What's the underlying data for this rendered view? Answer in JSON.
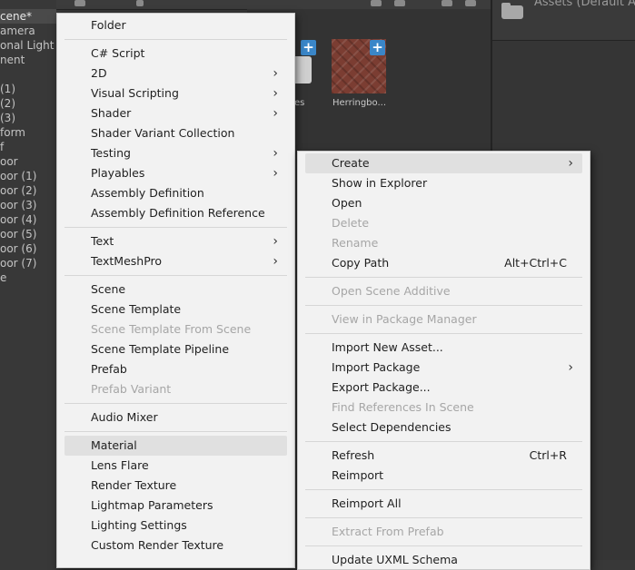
{
  "hierarchy": {
    "items": [
      {
        "label": "cene*",
        "selected": true
      },
      {
        "label": "amera"
      },
      {
        "label": "onal Light"
      },
      {
        "label": "nent"
      },
      {
        "label": " (1)"
      },
      {
        "label": " (2)"
      },
      {
        "label": " (3)"
      },
      {
        "label": "form"
      },
      {
        "label": "f"
      },
      {
        "label": "oor"
      },
      {
        "label": "oor (1)"
      },
      {
        "label": "oor (2)"
      },
      {
        "label": "oor (3)"
      },
      {
        "label": "oor (4)"
      },
      {
        "label": "oor (5)"
      },
      {
        "label": "oor (6)"
      },
      {
        "label": "oor (7)"
      },
      {
        "label": "e"
      }
    ]
  },
  "project": {
    "right_header_title": "Assets (Default A",
    "assets": [
      {
        "label": "es"
      },
      {
        "label": "Herringbo..."
      }
    ]
  },
  "create_menu": {
    "items": [
      {
        "type": "item",
        "label": "Folder"
      },
      {
        "type": "sep"
      },
      {
        "type": "item",
        "label": "C# Script"
      },
      {
        "type": "item",
        "label": "2D",
        "submenu": true
      },
      {
        "type": "item",
        "label": "Visual Scripting",
        "submenu": true
      },
      {
        "type": "item",
        "label": "Shader",
        "submenu": true
      },
      {
        "type": "item",
        "label": "Shader Variant Collection"
      },
      {
        "type": "item",
        "label": "Testing",
        "submenu": true
      },
      {
        "type": "item",
        "label": "Playables",
        "submenu": true
      },
      {
        "type": "item",
        "label": "Assembly Definition"
      },
      {
        "type": "item",
        "label": "Assembly Definition Reference"
      },
      {
        "type": "sep"
      },
      {
        "type": "item",
        "label": "Text",
        "submenu": true
      },
      {
        "type": "item",
        "label": "TextMeshPro",
        "submenu": true
      },
      {
        "type": "sep"
      },
      {
        "type": "item",
        "label": "Scene"
      },
      {
        "type": "item",
        "label": "Scene Template"
      },
      {
        "type": "item",
        "label": "Scene Template From Scene",
        "disabled": true
      },
      {
        "type": "item",
        "label": "Scene Template Pipeline"
      },
      {
        "type": "item",
        "label": "Prefab"
      },
      {
        "type": "item",
        "label": "Prefab Variant",
        "disabled": true
      },
      {
        "type": "sep"
      },
      {
        "type": "item",
        "label": "Audio Mixer"
      },
      {
        "type": "sep"
      },
      {
        "type": "item",
        "label": "Material",
        "highlight": true
      },
      {
        "type": "item",
        "label": "Lens Flare"
      },
      {
        "type": "item",
        "label": "Render Texture"
      },
      {
        "type": "item",
        "label": "Lightmap Parameters"
      },
      {
        "type": "item",
        "label": "Lighting Settings"
      },
      {
        "type": "item",
        "label": "Custom Render Texture"
      }
    ]
  },
  "context_menu": {
    "items": [
      {
        "type": "item",
        "label": "Create",
        "submenu": true,
        "highlight": true
      },
      {
        "type": "item",
        "label": "Show in Explorer"
      },
      {
        "type": "item",
        "label": "Open"
      },
      {
        "type": "item",
        "label": "Delete",
        "disabled": true
      },
      {
        "type": "item",
        "label": "Rename",
        "disabled": true
      },
      {
        "type": "item",
        "label": "Copy Path",
        "shortcut": "Alt+Ctrl+C"
      },
      {
        "type": "sep"
      },
      {
        "type": "item",
        "label": "Open Scene Additive",
        "disabled": true
      },
      {
        "type": "sep"
      },
      {
        "type": "item",
        "label": "View in Package Manager",
        "disabled": true
      },
      {
        "type": "sep"
      },
      {
        "type": "item",
        "label": "Import New Asset..."
      },
      {
        "type": "item",
        "label": "Import Package",
        "submenu": true
      },
      {
        "type": "item",
        "label": "Export Package..."
      },
      {
        "type": "item",
        "label": "Find References In Scene",
        "disabled": true
      },
      {
        "type": "item",
        "label": "Select Dependencies"
      },
      {
        "type": "sep"
      },
      {
        "type": "item",
        "label": "Refresh",
        "shortcut": "Ctrl+R"
      },
      {
        "type": "item",
        "label": "Reimport"
      },
      {
        "type": "sep"
      },
      {
        "type": "item",
        "label": "Reimport All"
      },
      {
        "type": "sep"
      },
      {
        "type": "item",
        "label": "Extract From Prefab",
        "disabled": true
      },
      {
        "type": "sep"
      },
      {
        "type": "item",
        "label": "Update UXML Schema"
      }
    ]
  },
  "icons": {
    "submenu_arrow": "chevron-right-icon",
    "folder": "folder-icon",
    "add": "plus-icon"
  },
  "colors": {
    "menu_bg": "#f2f2f2",
    "menu_text": "#1f1f1f",
    "disabled_text": "#a6a6a6",
    "highlight_bg": "#e0e0e0",
    "editor_bg": "#383838",
    "accent_blue": "#3a86c8"
  }
}
